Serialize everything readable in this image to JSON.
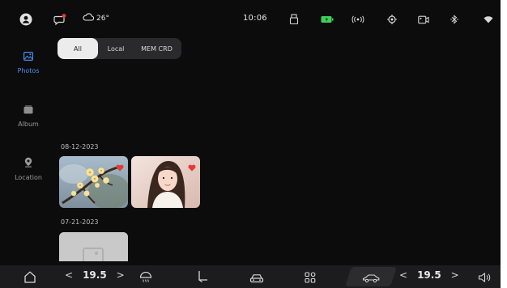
{
  "status_bar": {
    "time": "10:06",
    "temperature": "26°",
    "icons": [
      "user-icon",
      "message-icon",
      "cloud-icon",
      "usb-icon",
      "battery-icon",
      "radio-icon",
      "location-target-icon",
      "camera-icon",
      "bluetooth-icon",
      "wifi-icon"
    ],
    "battery_color": "#3ecf5a",
    "notification_dot_color": "#e53935"
  },
  "sidebar": {
    "items": [
      {
        "label": "Photos",
        "icon": "photos-icon",
        "active": true
      },
      {
        "label": "Album",
        "icon": "album-icon",
        "active": false
      },
      {
        "label": "Location",
        "icon": "location-pin-icon",
        "active": false
      }
    ],
    "accent_color": "#4a8fe8"
  },
  "filter": {
    "options": [
      "All",
      "Local",
      "MEM CRD"
    ],
    "selected": "All"
  },
  "sections": [
    {
      "date": "08-12-2023",
      "photos": [
        {
          "name": "plum-blossom-photo",
          "favorite": true
        },
        {
          "name": "portrait-photo",
          "favorite": true
        }
      ]
    },
    {
      "date": "07-21-2023",
      "photos": [
        {
          "name": "placeholder-photo",
          "favorite": false
        }
      ]
    }
  ],
  "dock": {
    "left_temp": "19.5",
    "right_temp": "19.5",
    "left_arrow": "<",
    "right_arrow": ">",
    "items": [
      "home-icon",
      "defrost-icon",
      "seat-icon",
      "car-front-icon",
      "apps-grid-icon",
      "car-side-icon",
      "volume-icon"
    ]
  }
}
